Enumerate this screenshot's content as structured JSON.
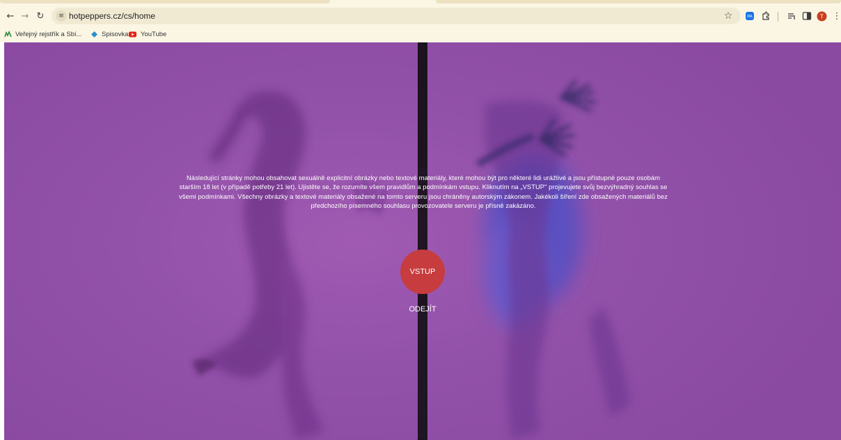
{
  "browser": {
    "url": "hotpeppers.cz/cs/home",
    "profile_initial": "T",
    "extension_badge": "PA",
    "bookmarks": [
      {
        "label": "Veřejný rejstřík a Sbí..."
      },
      {
        "label": "Spisovka"
      },
      {
        "label": "YouTube"
      }
    ]
  },
  "age_gate": {
    "disclaimer_lines": [
      "Následující stránky mohou obsahovat sexuálně explicitní obrázky nebo textové materiály, které mohou být pro některé lidi urážlivé a jsou přístupné pouze osobám",
      "starším 18 let (v případě potřeby 21 let). Ujistěte se, že rozumíte všem pravidlům a podmínkám vstupu. Kliknutím na „VSTUP\" projevujete svůj bezvýhradný souhlas se",
      "všemi podmínkami. Všechny obrázky a textové materiály obsažené na tomto serveru jsou chráněny autorským zákonem. Jakékoli šíření zde obsažených materiálů bez",
      "předchozího písemného souhlasu provozovatele serveru je přísně zakázáno."
    ],
    "enter_label": "VSTUP",
    "leave_label": "ODEJÍT"
  },
  "colors": {
    "chrome_bg": "#fbf6e4",
    "page_purple": "#8b4aa2",
    "enter_button": "#c73c3e",
    "profile_avatar": "#c8401e",
    "extension_blue": "#1a73e8"
  }
}
